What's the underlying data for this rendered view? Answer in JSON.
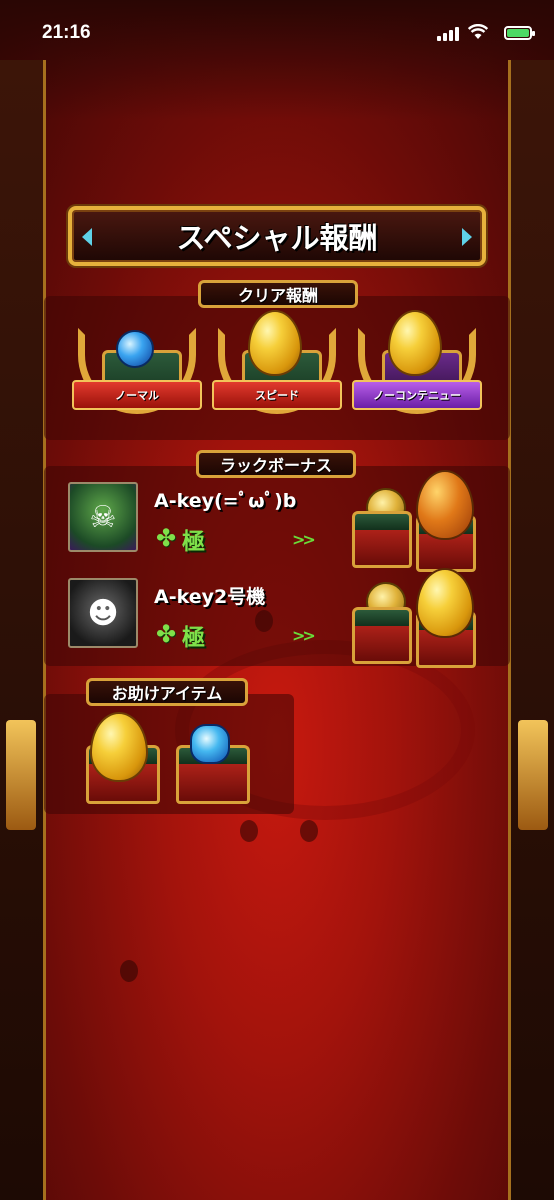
{
  "status_bar": {
    "time": "21:16"
  },
  "title": "スペシャル報酬",
  "clear_reward": {
    "label": "クリア報酬",
    "items": [
      {
        "ribbon": "ノーマル",
        "content": "orb",
        "ribbon_color": "#c8241a"
      },
      {
        "ribbon": "スピード",
        "content": "egg",
        "ribbon_color": "#c8241a"
      },
      {
        "ribbon": "ノーコンテニュー",
        "content": "egg",
        "ribbon_color": "#8a32c8"
      }
    ]
  },
  "luck_bonus": {
    "label": "ラックボーナス",
    "rows": [
      {
        "name": "A-key(=ﾟωﾟ)b",
        "grade": "極",
        "reward": "lucky-egg-hex"
      },
      {
        "name": "A-key2号機",
        "grade": "極",
        "reward": "lucky-egg-gold"
      }
    ]
  },
  "helper_items": {
    "label": "お助けアイテム",
    "items": [
      {
        "content": "egg"
      },
      {
        "content": "orb-gem"
      }
    ]
  },
  "colors": {
    "accent_gold": "#e6b13c",
    "background_red": "#a2130c",
    "luck_green": "#7fe04a"
  }
}
